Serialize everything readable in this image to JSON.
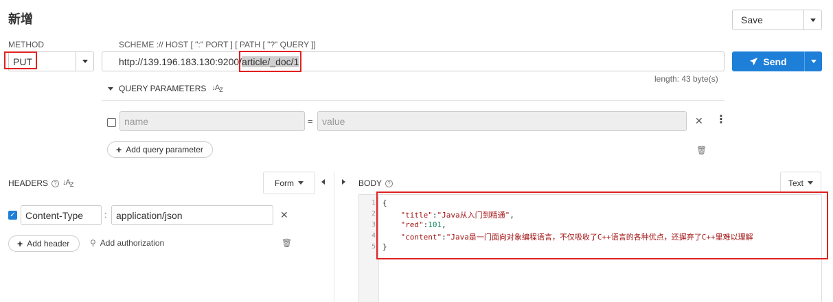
{
  "page_title": "新增",
  "save": {
    "label": "Save"
  },
  "method": {
    "label": "METHOD",
    "value": "PUT"
  },
  "url": {
    "label": "SCHEME :// HOST [ \":\" PORT ] [ PATH [ \"?\" QUERY ]]",
    "prefix": "http://139.196.183.130:9200/",
    "highlight": "article/_doc/1",
    "length": "length: 43 byte(s)"
  },
  "send": {
    "label": "Send"
  },
  "query": {
    "title": "QUERY PARAMETERS",
    "name_placeholder": "name",
    "value_placeholder": "value",
    "add_label": "Add query parameter"
  },
  "headers": {
    "title": "HEADERS",
    "form_label": "Form",
    "rows": [
      {
        "name": "Content-Type",
        "value": "application/json"
      }
    ],
    "add_label": "Add header",
    "auth_label": "Add authorization"
  },
  "body": {
    "title": "BODY",
    "type_label": "Text",
    "line_numbers": [
      "1",
      "2",
      "3",
      "4",
      "5"
    ],
    "lines": {
      "l1": "{",
      "title_key": "\"title\"",
      "title_val": "\"Java从入门到精通\"",
      "red_key": "\"red\"",
      "red_val": "101",
      "content_key": "\"content\"",
      "content_val": "\"Java是一门面向对象编程语言，不仅吸收了C++语言的各种优点，还摒弃了C++里难以理解",
      "l5": "}"
    }
  },
  "colors": {
    "accent": "#1e7fd8",
    "highlight_box": "#e02020"
  },
  "icons": [
    "caret-down-icon",
    "send-icon",
    "sort-icon",
    "help-icon",
    "close-icon",
    "kebab-icon",
    "trash-icon",
    "key-icon",
    "plus-icon"
  ]
}
